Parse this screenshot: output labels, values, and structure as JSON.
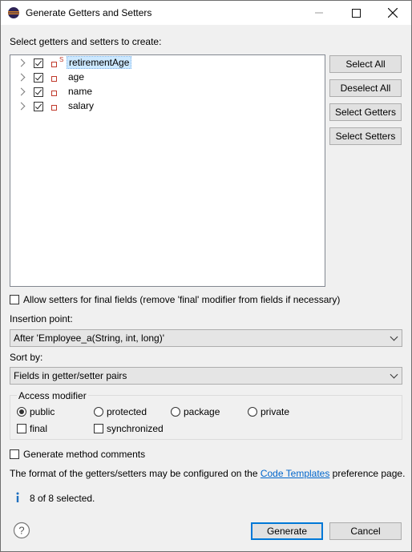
{
  "window": {
    "title": "Generate Getters and Setters"
  },
  "labels": {
    "select_prompt": "Select getters and setters to create:",
    "allow_final": "Allow setters for final fields (remove 'final' modifier from fields if necessary)",
    "insertion_point": "Insertion point:",
    "sort_by": "Sort by:",
    "access_modifier": "Access modifier",
    "generate_comments": "Generate method comments",
    "format_prefix": "The format of the getters/setters may be configured on the ",
    "format_link": "Code Templates",
    "format_suffix": " preference page.",
    "status": "8 of 8 selected."
  },
  "fields": [
    {
      "name": "retirementAge",
      "checked": true,
      "static": true,
      "static_mark": "S",
      "selected": true
    },
    {
      "name": "age",
      "checked": true,
      "static": false,
      "selected": false
    },
    {
      "name": "name",
      "checked": true,
      "static": false,
      "selected": false
    },
    {
      "name": "salary",
      "checked": true,
      "static": false,
      "selected": false
    }
  ],
  "side_buttons": {
    "select_all": "Select All",
    "deselect_all": "Deselect All",
    "select_getters": "Select Getters",
    "select_setters": "Select Setters"
  },
  "insertion_point": {
    "value": "After 'Employee_a(String, int, long)'"
  },
  "sort_by": {
    "value": "Fields in getter/setter pairs"
  },
  "access": {
    "options": [
      "public",
      "protected",
      "package",
      "private"
    ],
    "selected": "public",
    "final_label": "final",
    "synchronized_label": "synchronized"
  },
  "buttons": {
    "generate": "Generate",
    "cancel": "Cancel"
  },
  "icons": {
    "app": "eclipse-icon",
    "info": "info-icon",
    "help": "help-icon"
  },
  "colors": {
    "accent": "#0078d7",
    "selection": "#cce8ff",
    "link": "#0066cc",
    "field_icon": "#c0392b"
  }
}
